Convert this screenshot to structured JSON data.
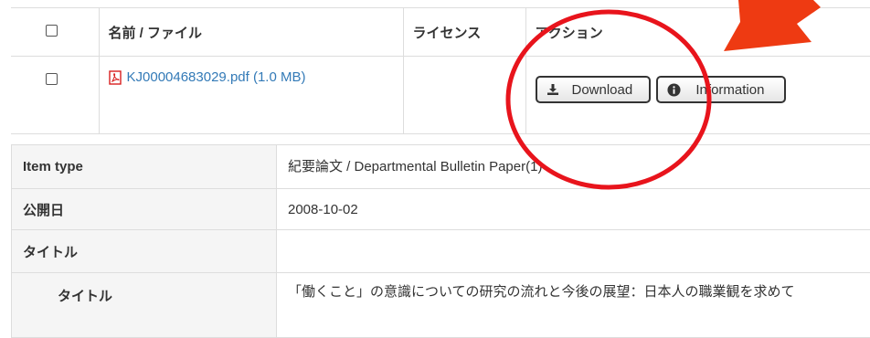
{
  "files_table": {
    "headers": {
      "name": "名前 / ファイル",
      "license": "ライセンス",
      "action": "アクション"
    },
    "rows": [
      {
        "file_name": "KJ00004683029.pdf (1.0 MB)",
        "license": "",
        "download_label": "Download",
        "information_label": "Information"
      }
    ]
  },
  "metadata": {
    "item_type": {
      "label": "Item type",
      "value": "紀要論文 / Departmental Bulletin Paper(1)"
    },
    "published": {
      "label": "公開日",
      "value": "2008-10-02"
    },
    "title_group": {
      "label": "タイトル",
      "value": ""
    },
    "title": {
      "label": "タイトル",
      "value": "「働くこと」の意識についての研究の流れと今後の展望：日本人の職業観を求めて"
    }
  },
  "annotations": {
    "circle_color": "#e8141c",
    "arrow_color": "#ee3a12"
  },
  "icons": [
    "checkbox-icon",
    "pdf-icon",
    "download-icon",
    "info-icon"
  ]
}
